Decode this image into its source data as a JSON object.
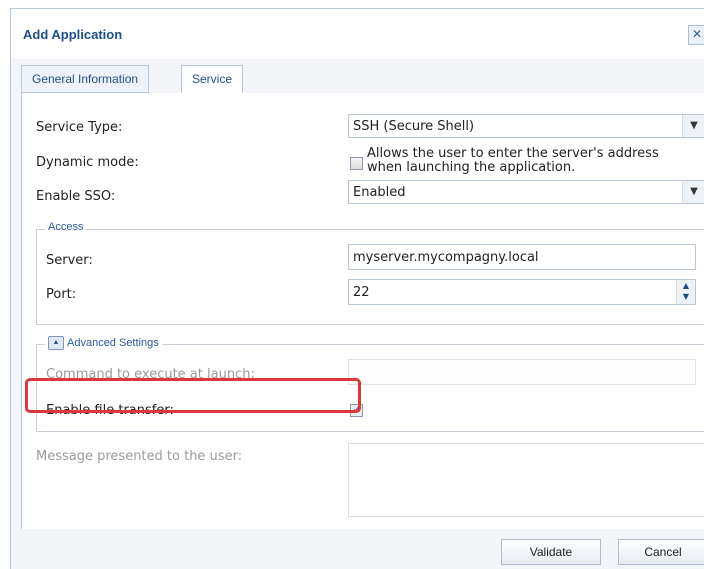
{
  "dialog": {
    "title": "Add Application",
    "close_glyph": "✕"
  },
  "tabs": [
    {
      "label": "General Information",
      "active": false
    },
    {
      "label": "Service",
      "active": true
    }
  ],
  "form": {
    "service_type": {
      "label": "Service Type:",
      "value": "SSH (Secure Shell)"
    },
    "dynamic_mode": {
      "label": "Dynamic mode:",
      "checked": false,
      "description_line1": "Allows the user to enter the server's address",
      "description_line2": "when launching the application."
    },
    "enable_sso": {
      "label": "Enable SSO:",
      "value": "Enabled"
    }
  },
  "access": {
    "legend": "Access",
    "server": {
      "label": "Server:",
      "value": "myserver.mycompagny.local"
    },
    "port": {
      "label": "Port:",
      "value": "22"
    }
  },
  "advanced": {
    "legend": "Advanced Settings",
    "command": {
      "label": "Command to execute at launch:",
      "value": ""
    },
    "file_transfer": {
      "label": "Enable file transfer:",
      "checked": true
    }
  },
  "message": {
    "label": "Message presented to the user:",
    "value": ""
  },
  "buttons": {
    "validate": "Validate",
    "cancel": "Cancel"
  },
  "colors": {
    "highlight": "#e0353b",
    "title": "#1f4f8a",
    "legend": "#2a5aa0"
  },
  "icons": {
    "dropdown": "chevron-down-icon",
    "spinner": "spinner-arrows-icon",
    "collapse": "collapse-up-icon",
    "close": "close-icon"
  }
}
